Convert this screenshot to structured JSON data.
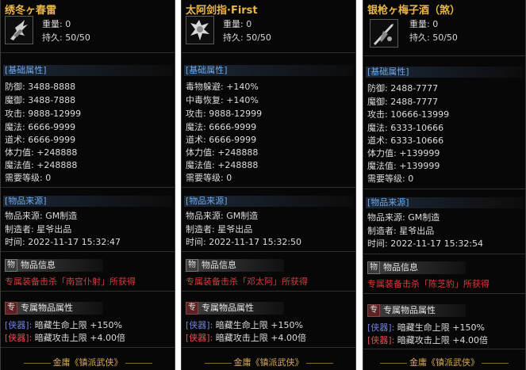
{
  "panels": [
    {
      "title": "绣冬ヶ春雷",
      "weight": "重量: 0",
      "durability": "持久: 50/50",
      "base_header": "[基础属性]",
      "attrs": [
        "防御: 3488-8888",
        "魔御: 3488-7888",
        "攻击: 9888-12999",
        "魔法: 6666-9999",
        "道术: 6666-9999",
        "体力值: +248888",
        "魔法值: +248888",
        "需要等级: 0"
      ],
      "source_header": "[物品来源]",
      "source": [
        "物品来源: GM制造",
        "制造者: 星爷出品",
        "时间: 2022-11-17 15:32:47"
      ],
      "info_tag": "物",
      "info_label": "物品信息",
      "kill_text": "专属装备击杀「南宫仆射」所获得",
      "excl_tag": "专",
      "excl_label": "专属物品属性",
      "xq1_bracket": "[侠器]:",
      "xq1_text": "暗藏生命上限 +150%",
      "xq2_bracket": "[侠器]:",
      "xq2_text": "暗藏攻击上限 +4.00倍",
      "footer": "金庸《镇派武侠》"
    },
    {
      "title": "太阿剑指·First",
      "weight": "重量: 0",
      "durability": "持久: 50/50",
      "base_header": "[基础属性]",
      "attrs": [
        "毒物躲避: +140%",
        "中毒恢复: +140%",
        "攻击: 9888-12999",
        "魔法: 6666-9999",
        "道术: 6666-9999",
        "体力值: +248888",
        "魔法值: +248888",
        "需要等级: 0"
      ],
      "source_header": "[物品来源]",
      "source": [
        "物品来源: GM制造",
        "制造者: 星爷出品",
        "时间: 2022-11-17 15:32:50"
      ],
      "info_tag": "物",
      "info_label": "物品信息",
      "kill_text": "专属装备击杀「邓太阿」所获得",
      "excl_tag": "专",
      "excl_label": "专属物品属性",
      "xq1_bracket": "[侠器]:",
      "xq1_text": "暗藏生命上限 +150%",
      "xq2_bracket": "[侠器]:",
      "xq2_text": "暗藏攻击上限 +4.00倍",
      "footer": "金庸《镇派武侠》"
    },
    {
      "title": "银枪ヶ梅子酒（煞）",
      "weight": "重量: 0",
      "durability": "持久: 50/50",
      "base_header": "[基础属性]",
      "attrs": [
        "防御: 2488-7777",
        "魔御: 2488-7777",
        "攻击: 10666-13999",
        "魔法: 6333-10666",
        "道术: 6333-10666",
        "体力值: +139999",
        "魔法值: +139999",
        "需要等级: 0"
      ],
      "source_header": "[物品来源]",
      "source": [
        "物品来源: GM制造",
        "制造者: 星爷出品",
        "时间: 2022-11-17 15:32:54"
      ],
      "info_tag": "物",
      "info_label": "物品信息",
      "kill_text": "专属装备击杀「陈芝豹」所获得",
      "excl_tag": "专",
      "excl_label": "专属物品属性",
      "xq1_bracket": "[侠器]:",
      "xq1_text": "暗藏生命上限 +150%",
      "xq2_bracket": "[侠器]:",
      "xq2_text": "暗藏攻击上限 +4.00倍",
      "footer": "金庸《镇派武侠》"
    }
  ],
  "colors": {
    "title": "#e8b64a",
    "section_header": "#6ea8e8",
    "kill_text": "#d93a3a",
    "footer": "#d8a850"
  }
}
